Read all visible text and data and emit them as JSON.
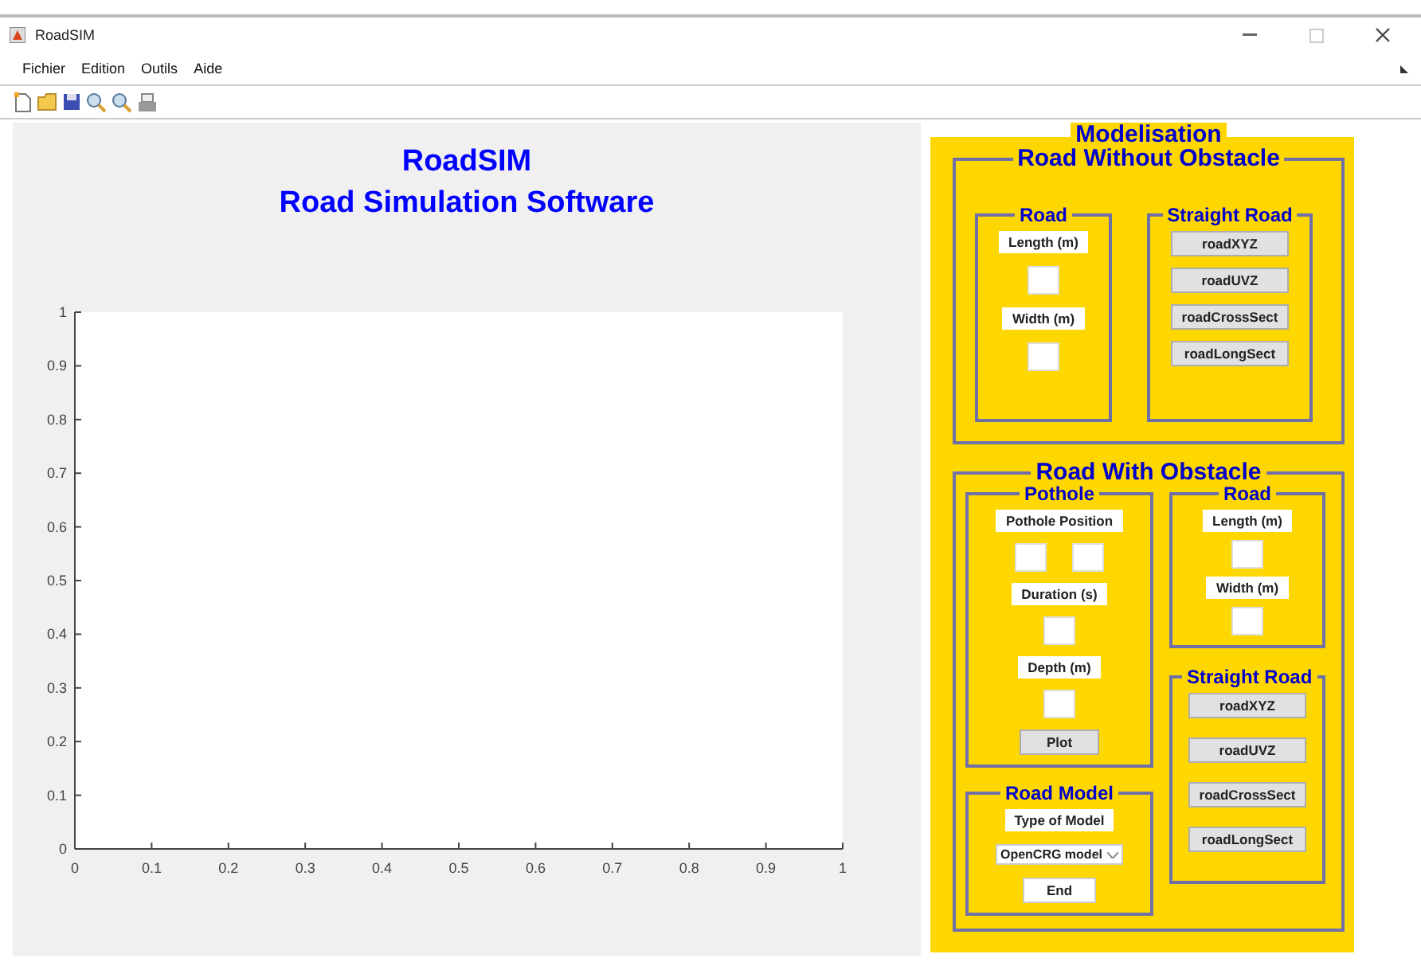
{
  "window": {
    "title": "RoadSIM"
  },
  "menu": [
    "Fichier",
    "Edition",
    "Outils",
    "Aide"
  ],
  "heading": [
    "RoadSIM",
    "Road Simulation Software"
  ],
  "chart": {
    "chart_data": {
      "type": "line",
      "xlim": [
        0,
        1
      ],
      "ylim": [
        0,
        1
      ],
      "xticks": [
        0,
        0.1,
        0.2,
        0.3,
        0.4,
        0.5,
        0.6,
        0.7,
        0.8,
        0.9,
        1
      ],
      "yticks": [
        0,
        0.1,
        0.2,
        0.3,
        0.4,
        0.5,
        0.6,
        0.7,
        0.8,
        0.9,
        1
      ]
    }
  },
  "modelisation": {
    "title": "Modelisation",
    "without_obstacle": {
      "title": "Road Without Obstacle",
      "road": {
        "title": "Road",
        "fields": [
          {
            "label": "Length (m)",
            "kind": "single"
          },
          {
            "label": "Width (m)",
            "kind": "single"
          }
        ]
      },
      "straight_road": {
        "title": "Straight Road",
        "buttons": [
          "roadXYZ",
          "roadUVZ",
          "roadCrossSect",
          "roadLongSect"
        ]
      }
    },
    "with_obstacle": {
      "title": "Road With Obstacle",
      "pothole": {
        "title": "Pothole",
        "fields": [
          {
            "label": "Pothole Position",
            "kind": "pair"
          },
          {
            "label": "Duration (s)",
            "kind": "single"
          },
          {
            "label": "Depth (m)",
            "kind": "single"
          }
        ],
        "button": "Plot"
      },
      "road": {
        "title": "Road",
        "fields": [
          {
            "label": "Length (m)",
            "kind": "single"
          },
          {
            "label": "Width (m)",
            "kind": "single"
          }
        ]
      },
      "straight_road": {
        "title": "Straight Road",
        "buttons": [
          "roadXYZ",
          "roadUVZ",
          "roadCrossSect",
          "roadLongSect"
        ]
      },
      "road_model": {
        "title": "Road Model",
        "label": "Type of Model",
        "select": "OpenCRG model",
        "button": "End"
      }
    }
  }
}
